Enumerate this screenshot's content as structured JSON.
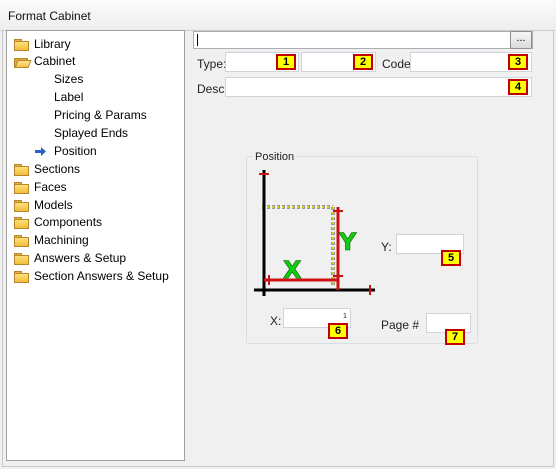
{
  "window": {
    "title": "Format Cabinet"
  },
  "tree": {
    "items": [
      {
        "label": "Library",
        "icon": "folder-icon"
      },
      {
        "label": "Cabinet",
        "icon": "folder-open-icon"
      },
      {
        "label": "Sizes"
      },
      {
        "label": "Label"
      },
      {
        "label": "Pricing & Params"
      },
      {
        "label": "Splayed Ends"
      },
      {
        "label": "Position",
        "icon": "arrow-right-icon",
        "selected": true
      },
      {
        "label": "Sections",
        "icon": "folder-icon"
      },
      {
        "label": "Faces",
        "icon": "folder-icon"
      },
      {
        "label": "Models",
        "icon": "folder-icon"
      },
      {
        "label": "Components",
        "icon": "folder-icon"
      },
      {
        "label": "Machining",
        "icon": "folder-icon"
      },
      {
        "label": "Answers & Setup",
        "icon": "folder-icon"
      },
      {
        "label": "Section Answers & Setup",
        "icon": "folder-icon"
      }
    ]
  },
  "form": {
    "name_value": "",
    "browse_label": "...",
    "type_label": "Type:",
    "code_label": "Code:",
    "desc_label": "Desc:",
    "x_label": "X:",
    "y_label": "Y:",
    "page_label": "Page #",
    "spin_value": "1",
    "group_title": "Position"
  },
  "badges": [
    "1",
    "2",
    "3",
    "4",
    "5",
    "6",
    "7"
  ],
  "diagram_labels": {
    "x": "X",
    "y": "Y"
  },
  "colors": {
    "badge_fill": "#ffff00",
    "badge_border": "#c00000",
    "diagram_red": "#cc1111",
    "diagram_green": "#11cc11",
    "selection_arrow": "#2a62c9"
  }
}
